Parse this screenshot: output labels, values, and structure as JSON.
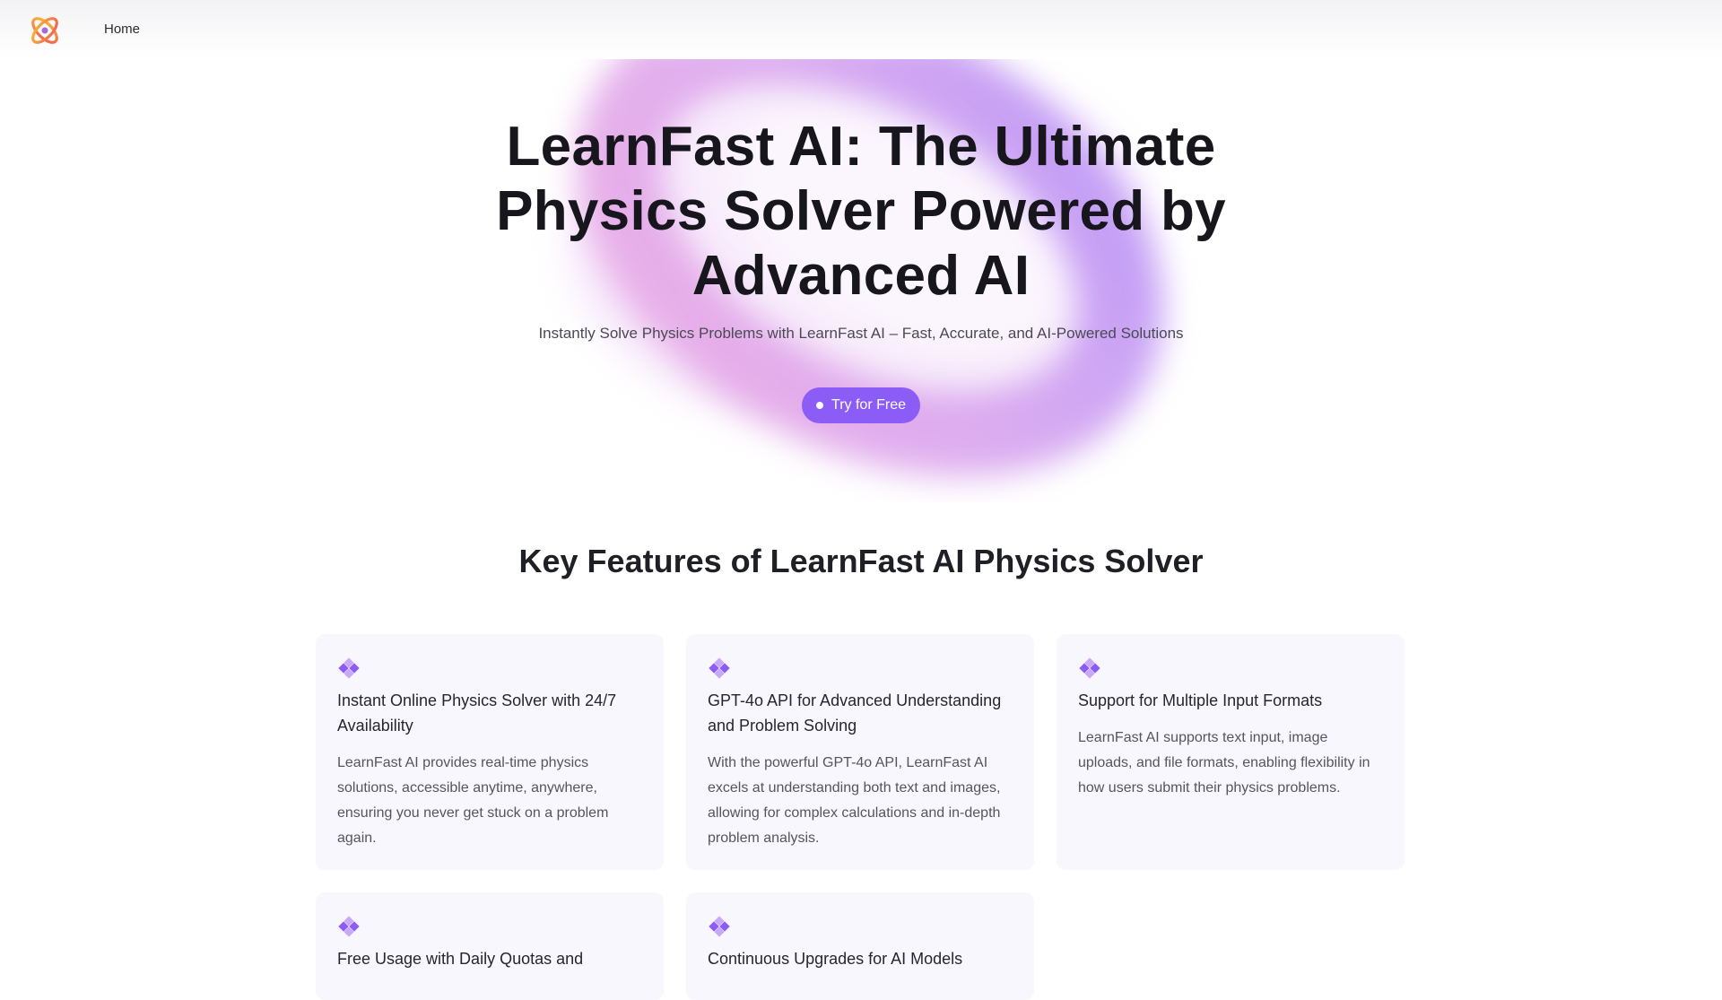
{
  "nav": {
    "home_label": "Home"
  },
  "hero": {
    "title": "LearnFast AI: The Ultimate Physics Solver Powered by Advanced AI",
    "subtitle": "Instantly Solve Physics Problems with LearnFast AI – Fast, Accurate, and AI-Powered Solutions",
    "cta_label": "Try for Free"
  },
  "features": {
    "title": "Key Features of LearnFast AI Physics Solver",
    "cards": [
      {
        "title": "Instant Online Physics Solver with 24/7 Availability",
        "desc": "LearnFast AI provides real-time physics solutions, accessible anytime, anywhere, ensuring you never get stuck on a problem again."
      },
      {
        "title": "GPT-4o API for Advanced Understanding and Problem Solving",
        "desc": "With the powerful GPT-4o API, LearnFast AI excels at understanding both text and images, allowing for complex calculations and in-depth problem analysis."
      },
      {
        "title": "Support for Multiple Input Formats",
        "desc": "LearnFast AI supports text input, image uploads, and file formats, enabling flexibility in how users submit their physics problems."
      },
      {
        "title": "Free Usage with Daily Quotas and",
        "desc": ""
      },
      {
        "title": "Continuous Upgrades for AI Models",
        "desc": ""
      }
    ]
  },
  "colors": {
    "accent": "#8b5cf6",
    "card_bg": "#f8f7fd",
    "heading": "#16161c"
  },
  "icons": {
    "logo": "atom-logo-icon",
    "feature": "diamond-cluster-icon"
  }
}
